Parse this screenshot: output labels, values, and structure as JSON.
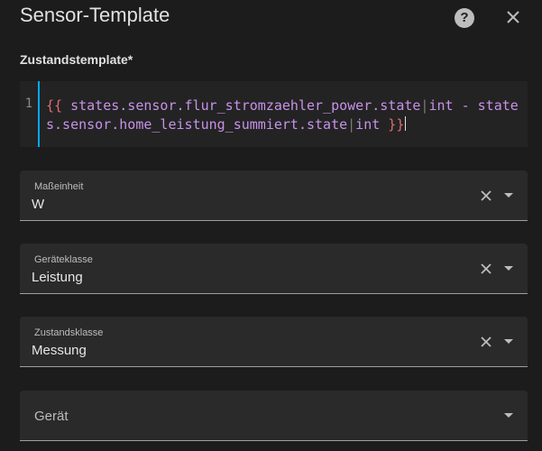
{
  "dialog": {
    "title": "Sensor-Template"
  },
  "template": {
    "label": "Zustandstemplate*",
    "line_number": "1",
    "open_brace": "{{",
    "part1": " states.sensor.flur_stromzaehler_power.state",
    "pipe": "|",
    "part2": "int - states.sensor.home_leistung_summiert.state",
    "part3": "int ",
    "close_brace": "}}"
  },
  "fields": {
    "unit": {
      "label": "Maßeinheit",
      "value": "W"
    },
    "device_class": {
      "label": "Geräteklasse",
      "value": "Leistung"
    },
    "state_class": {
      "label": "Zustandsklasse",
      "value": "Messung"
    },
    "device": {
      "placeholder": "Gerät"
    }
  },
  "icons": {
    "help": "help-circle-icon",
    "close": "close-icon",
    "clear": "clear-icon",
    "dropdown": "caret-down-icon"
  }
}
